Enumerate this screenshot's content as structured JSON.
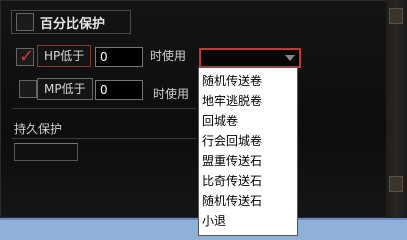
{
  "section_title": "百分比保护",
  "hp_row": {
    "label": "HP低于",
    "value": "0",
    "suffix": "时使用",
    "checked": true
  },
  "mp_row": {
    "label": "MP低于",
    "value": "0",
    "suffix": "时使用",
    "checked": false
  },
  "persist_title": "持久保护",
  "dropdown": {
    "selected": "",
    "options": [
      "随机传送卷",
      "地牢逃脱卷",
      "回城卷",
      "行会回城卷",
      "盟重传送石",
      "比奇传送石",
      "随机传送石",
      "小退"
    ]
  },
  "colors": {
    "accent": "#c0392b",
    "check": "#dd3333",
    "bottom_bar": "#8fb0d9"
  }
}
